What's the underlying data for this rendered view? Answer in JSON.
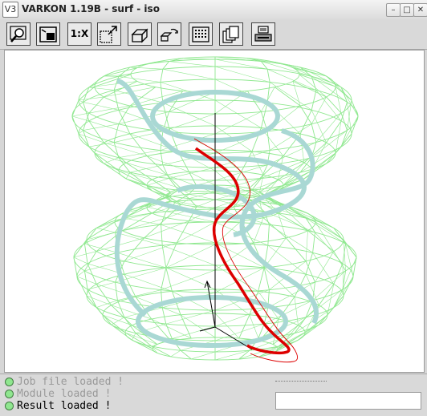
{
  "window": {
    "app_logo_text": "V3",
    "title": "VARKON 1.19B - surf - iso",
    "minimize_glyph": "–",
    "maximize_glyph": "□",
    "close_glyph": "✕"
  },
  "toolbar": {
    "buttons": [
      {
        "name": "zoom-icon"
      },
      {
        "name": "window-view-icon"
      },
      {
        "name": "scale-1-to-x-button",
        "label": "1:X"
      },
      {
        "name": "auto-scale-icon"
      },
      {
        "name": "perspective-icon"
      },
      {
        "name": "rotate-view-icon"
      },
      {
        "name": "grid-icon"
      },
      {
        "name": "levels-icon"
      },
      {
        "name": "print-icon"
      }
    ]
  },
  "viewport": {
    "mesh_color": "#90e890",
    "iso_curve_color": "#a9d8d4",
    "highlight_curve_color": "#dd0000",
    "axis_color": "#000000"
  },
  "status": {
    "messages": [
      {
        "text": "Job file loaded !",
        "state": "dim"
      },
      {
        "text": "Module loaded !",
        "state": "dim"
      },
      {
        "text": "Result loaded !",
        "state": "active"
      }
    ],
    "led_color": "#8fe68f"
  }
}
